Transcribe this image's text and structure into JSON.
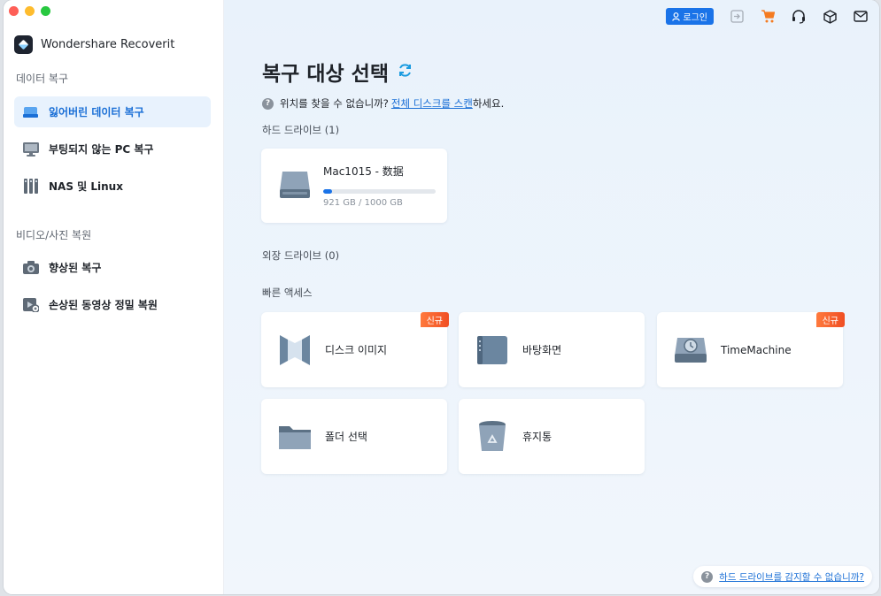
{
  "app": {
    "name": "Wondershare Recoverit"
  },
  "sidebar": {
    "section1": "데이터 복구",
    "items1": [
      {
        "label": "잃어버린 데이터 복구",
        "icon": "drive-icon",
        "active": true
      },
      {
        "label": "부팅되지 않는 PC 복구",
        "icon": "monitor-icon",
        "active": false
      },
      {
        "label": "NAS 및 Linux",
        "icon": "nas-icon",
        "active": false
      }
    ],
    "section2": "비디오/사진 복원",
    "items2": [
      {
        "label": "향상된 복구",
        "icon": "camera-icon"
      },
      {
        "label": "손상된 동영상 정밀 복원",
        "icon": "video-repair-icon"
      }
    ]
  },
  "topbar": {
    "login_label": "로그인"
  },
  "main": {
    "title": "복구 대상 선택",
    "help_prefix": "위치를 찾을 수 없습니까?",
    "help_link": "전체 디스크를 스캔",
    "help_suffix": "하세요.",
    "hard_drives_label": "하드 드라이브 (1)",
    "drive": {
      "name": "Mac1015 - 数据",
      "size": "921 GB / 1000 GB",
      "used_fraction": 0.08
    },
    "external_label": "외장 드라이브 (0)",
    "quick_access_label": "빠른 액세스",
    "quick_access": [
      {
        "label": "디스크 이미지",
        "icon": "disk-image-icon",
        "badge": "신규"
      },
      {
        "label": "바탕화면",
        "icon": "desktop-icon"
      },
      {
        "label": "TimeMachine",
        "icon": "time-machine-icon",
        "badge": "신규"
      },
      {
        "label": "폴더 선택",
        "icon": "folder-icon"
      },
      {
        "label": "휴지통",
        "icon": "trash-icon"
      }
    ]
  },
  "bottom_help": {
    "label": "하드 드라이브를 감지할 수 없습니까?"
  },
  "colors": {
    "accent": "#1a73e8",
    "badge": "#f04e23"
  }
}
